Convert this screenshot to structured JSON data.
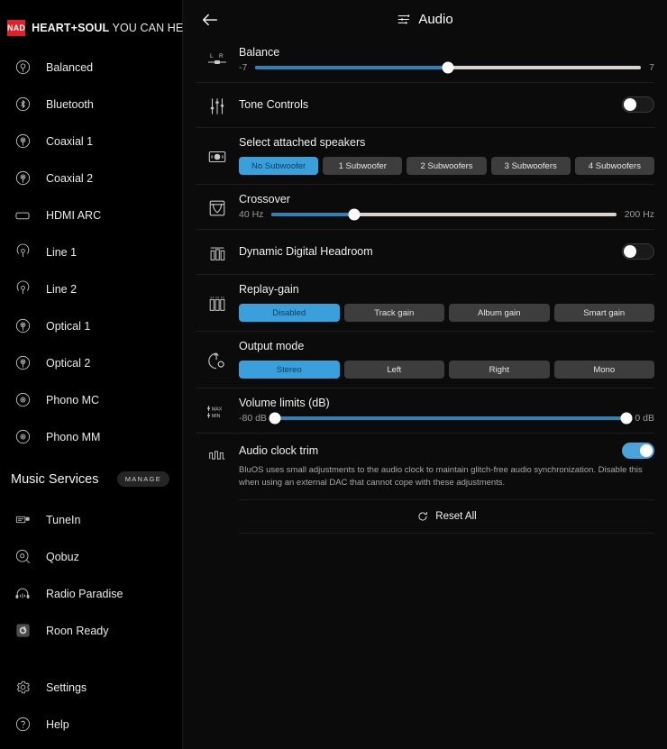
{
  "brand": {
    "logo": "NAD",
    "tagline_bold": "HEART+SOUL",
    "tagline_light": "YOU CAN HEAR"
  },
  "sidebar": {
    "inputs": [
      {
        "label": "Balanced",
        "icon": "balanced-input-icon"
      },
      {
        "label": "Bluetooth",
        "icon": "bluetooth-icon"
      },
      {
        "label": "Coaxial 1",
        "icon": "coaxial-icon"
      },
      {
        "label": "Coaxial 2",
        "icon": "coaxial-icon"
      },
      {
        "label": "HDMI ARC",
        "icon": "hdmi-arc-icon"
      },
      {
        "label": "Line 1",
        "icon": "line-input-icon"
      },
      {
        "label": "Line 2",
        "icon": "line-input-icon"
      },
      {
        "label": "Optical 1",
        "icon": "optical-icon"
      },
      {
        "label": "Optical 2",
        "icon": "optical-icon"
      },
      {
        "label": "Phono MC",
        "icon": "phono-icon"
      },
      {
        "label": "Phono MM",
        "icon": "phono-icon"
      }
    ],
    "music_services": {
      "title": "Music Services",
      "manage_label": "MANAGE",
      "items": [
        {
          "label": "TuneIn",
          "icon": "tunein-icon"
        },
        {
          "label": "Qobuz",
          "icon": "qobuz-icon"
        },
        {
          "label": "Radio Paradise",
          "icon": "radio-paradise-icon"
        },
        {
          "label": "Roon Ready",
          "icon": "roon-ready-icon"
        }
      ]
    },
    "bottom": [
      {
        "label": "Settings",
        "icon": "gear-icon"
      },
      {
        "label": "Help",
        "icon": "help-icon"
      }
    ]
  },
  "header": {
    "title": "Audio",
    "back_icon": "back-arrow-icon",
    "title_icon": "audio-sliders-icon"
  },
  "balance": {
    "label": "Balance",
    "icon": "left-right-balance-icon",
    "min_label": "-7",
    "max_label": "7",
    "value_percent": 50
  },
  "tone_controls": {
    "label": "Tone Controls",
    "icon": "tone-sliders-icon",
    "enabled": false
  },
  "speakers": {
    "label": "Select attached speakers",
    "icon": "subwoofer-speaker-icon",
    "options": [
      "No Subwoofer",
      "1 Subwoofer",
      "2 Subwoofers",
      "3 Subwoofers",
      "4 Subwoofers"
    ],
    "selected_index": 0
  },
  "crossover": {
    "label": "Crossover",
    "icon": "crossover-curve-icon",
    "min_label": "40 Hz",
    "max_label": "200 Hz",
    "value_percent": 24
  },
  "headroom": {
    "label": "Dynamic Digital Headroom",
    "icon": "headroom-bars-icon",
    "enabled": false
  },
  "replay_gain": {
    "label": "Replay-gain",
    "icon": "replay-gain-bars-icon",
    "options": [
      "Disabled",
      "Track gain",
      "Album gain",
      "Smart gain"
    ],
    "selected_index": 0
  },
  "output_mode": {
    "label": "Output mode",
    "icon": "output-mode-icon",
    "options": [
      "Stereo",
      "Left",
      "Right",
      "Mono"
    ],
    "selected_index": 0
  },
  "volume_limits": {
    "label": "Volume limits (dB)",
    "icon": "max-min-icon",
    "min_label": "-80 dB",
    "max_label": "0 dB",
    "low_percent": 0,
    "high_percent": 100
  },
  "audio_clock_trim": {
    "label": "Audio clock trim",
    "icon": "clock-waveform-icon",
    "enabled": true,
    "description": "BluOS uses small adjustments to the audio clock to maintain glitch-free audio synchronization. Disable this when using an external DAC that cannot cope with these adjustments."
  },
  "reset": {
    "label": "Reset All",
    "icon": "reset-icon"
  },
  "colors": {
    "accent": "#3aa0dc",
    "slider_fill": "#2e82b7",
    "brand_red": "#e0202a",
    "segment_bg": "#3d3d3d"
  }
}
